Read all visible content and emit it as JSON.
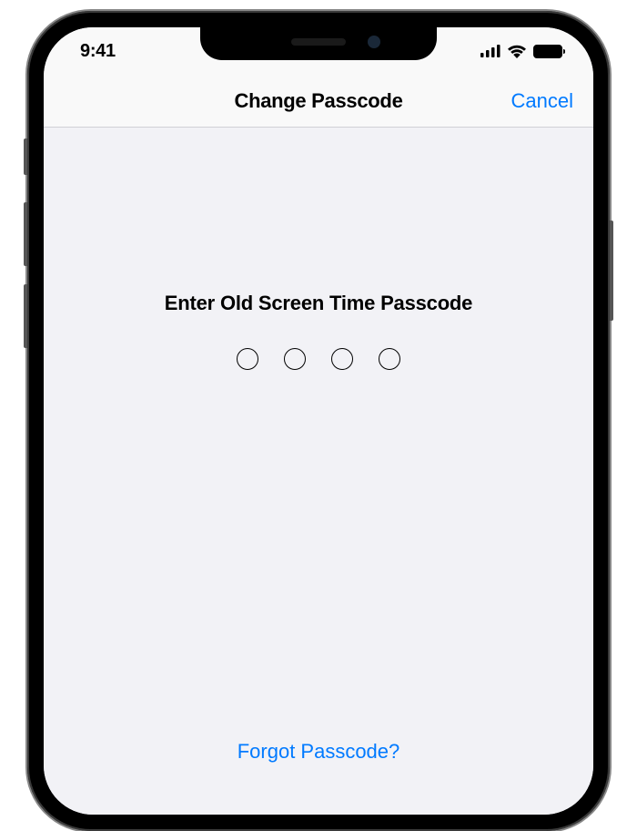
{
  "statusBar": {
    "time": "9:41"
  },
  "navBar": {
    "title": "Change Passcode",
    "cancel": "Cancel"
  },
  "content": {
    "prompt": "Enter Old Screen Time Passcode",
    "passcodeLength": 4,
    "forgotLink": "Forgot Passcode?"
  },
  "colors": {
    "tint": "#007aff",
    "background": "#f2f2f6",
    "barBackground": "#f9f9f9"
  }
}
